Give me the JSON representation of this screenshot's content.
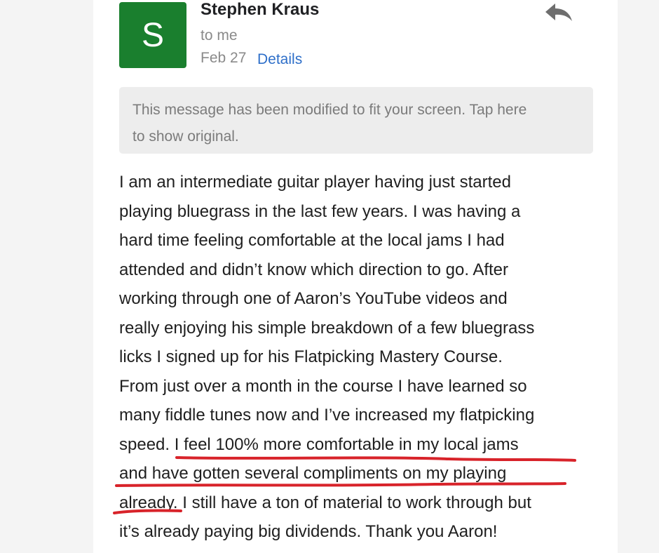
{
  "sender": {
    "name": "Stephen Kraus",
    "avatar_letter": "S",
    "avatar_color": "#1a7f2e"
  },
  "recipient": "to me",
  "date": "Feb 27",
  "details_link": "Details",
  "reply_icon": "reply-icon",
  "notice": {
    "line1": "This message has been modified to fit your screen. Tap here",
    "line2": "to show original."
  },
  "body_lines": [
    "I am an intermediate guitar player having just started",
    "playing bluegrass in the last few years. I was having a",
    "hard time feeling comfortable at the local jams I had",
    "attended and didn’t know which direction to go. After",
    "working through one of Aaron’s YouTube videos and",
    "really enjoying his simple breakdown of a few bluegrass",
    "licks I signed up for his Flatpicking Mastery Course.",
    "From just over a month in the course I have learned so",
    "many fiddle tunes now and I’ve increased my flatpicking",
    "speed. I feel 100% more comfortable in my local jams",
    "and have gotten several compliments on my playing",
    "already. I still have a ton of material to work through but",
    "it’s already paying big dividends. Thank you Aaron!"
  ],
  "colors": {
    "underline": "#d8232a",
    "link": "#2e6fc9",
    "panel_gray": "#f4f4f4"
  }
}
